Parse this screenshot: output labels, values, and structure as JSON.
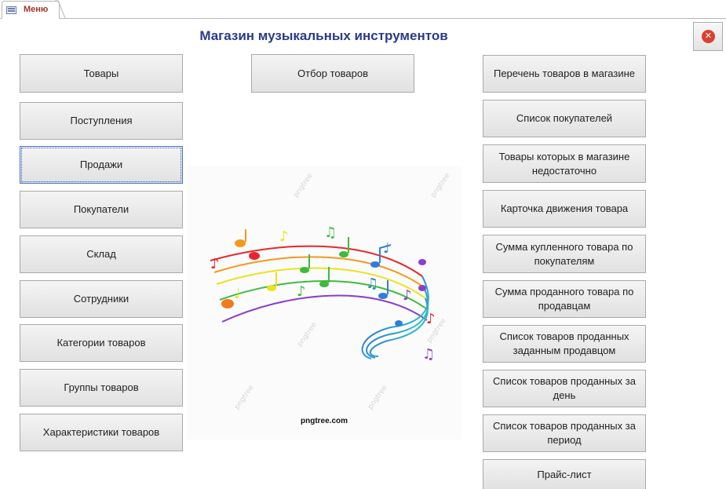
{
  "tab": {
    "label": "Меню",
    "icon": "form-icon"
  },
  "title": "Магазин музыкальных инструментов",
  "close_button": {
    "icon": "close-icon"
  },
  "left_buttons": [
    "Товары",
    "Поступления",
    "Продажи",
    "Покупатели",
    "Склад",
    "Сотрудники",
    "Категории товаров",
    "Группы товаров",
    "Характеристики товаров"
  ],
  "middle_button": "Отбор товаров",
  "right_buttons": [
    "Перечень товаров в магазине",
    "Список покупателей",
    "Товары которых в магазине недостаточно",
    "Карточка движения товара",
    "Сумма купленного товара по покупателям",
    "Сумма проданного товара по продавцам",
    "Список товаров проданных заданным продавцом",
    "Список товаров проданных за день",
    "Список товаров проданных за период",
    "Прайс-лист"
  ],
  "image": {
    "caption": "pngtree.com",
    "icon": "music-notes-image"
  },
  "colors": {
    "title": "#2b3a8c",
    "tab_label": "#a0352b",
    "close": "#d9412f"
  }
}
